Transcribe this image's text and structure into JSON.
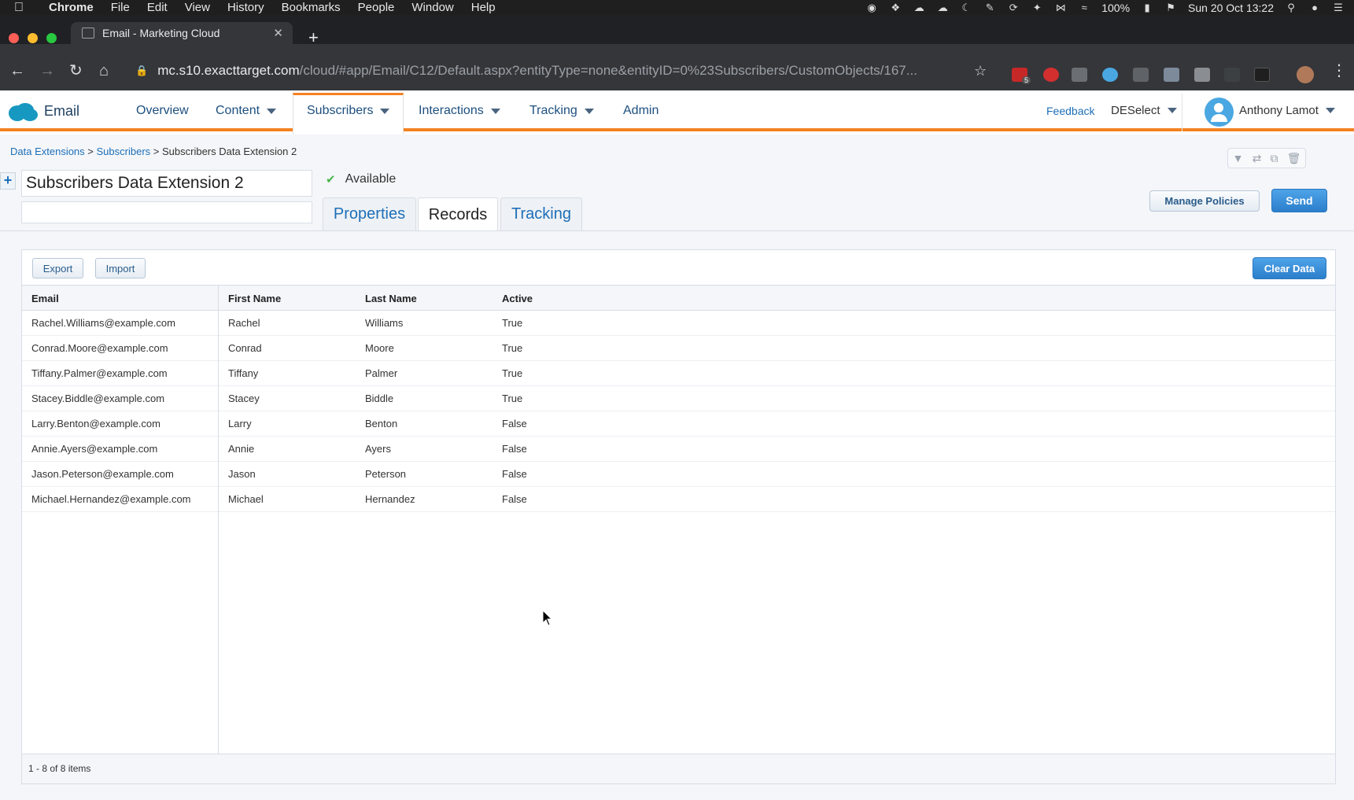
{
  "mac_menubar": {
    "app": "Chrome",
    "items": [
      "File",
      "Edit",
      "View",
      "History",
      "Bookmarks",
      "People",
      "Window",
      "Help"
    ],
    "battery": "100%",
    "datetime": "Sun 20 Oct 13:22"
  },
  "browser": {
    "tab_title": "Email - Marketing Cloud",
    "url_host": "mc.s10.exacttarget.com",
    "url_path": "/cloud/#app/Email/C12/Default.aspx?entityType=none&entityID=0%23Subscribers/CustomObjects/167...",
    "extension_badge": "5"
  },
  "app_header": {
    "app_name": "Email",
    "nav": [
      {
        "label": "Overview",
        "has_menu": false
      },
      {
        "label": "Content",
        "has_menu": true
      },
      {
        "label": "Subscribers",
        "has_menu": true,
        "active": true
      },
      {
        "label": "Interactions",
        "has_menu": true
      },
      {
        "label": "Tracking",
        "has_menu": true
      },
      {
        "label": "Admin",
        "has_menu": false
      }
    ],
    "feedback": "Feedback",
    "deselect": "DESelect",
    "user_name": "Anthony Lamot",
    "accent_color": "#f48220"
  },
  "breadcrumb": {
    "items": [
      "Data Extensions",
      "Subscribers"
    ],
    "current": "Subscribers Data Extension 2",
    "separator": ">"
  },
  "data_extension": {
    "name": "Subscribers Data Extension 2",
    "description": "",
    "status": "Available"
  },
  "tabs": [
    "Properties",
    "Records",
    "Tracking"
  ],
  "active_tab": "Records",
  "actions": {
    "manage_policies": "Manage Policies",
    "send": "Send",
    "export": "Export",
    "import": "Import",
    "clear_data": "Clear Data"
  },
  "grid": {
    "columns": [
      "Email",
      "First Name",
      "Last Name",
      "Active"
    ],
    "rows": [
      [
        "Rachel.Williams@example.com",
        "Rachel",
        "Williams",
        "True"
      ],
      [
        "Conrad.Moore@example.com",
        "Conrad",
        "Moore",
        "True"
      ],
      [
        "Tiffany.Palmer@example.com",
        "Tiffany",
        "Palmer",
        "True"
      ],
      [
        "Stacey.Biddle@example.com",
        "Stacey",
        "Biddle",
        "True"
      ],
      [
        "Larry.Benton@example.com",
        "Larry",
        "Benton",
        "False"
      ],
      [
        "Annie.Ayers@example.com",
        "Annie",
        "Ayers",
        "False"
      ],
      [
        "Jason.Peterson@example.com",
        "Jason",
        "Peterson",
        "False"
      ],
      [
        "Michael.Hernandez@example.com",
        "Michael",
        "Hernandez",
        "False"
      ]
    ],
    "footer": "1 - 8 of 8 items"
  }
}
